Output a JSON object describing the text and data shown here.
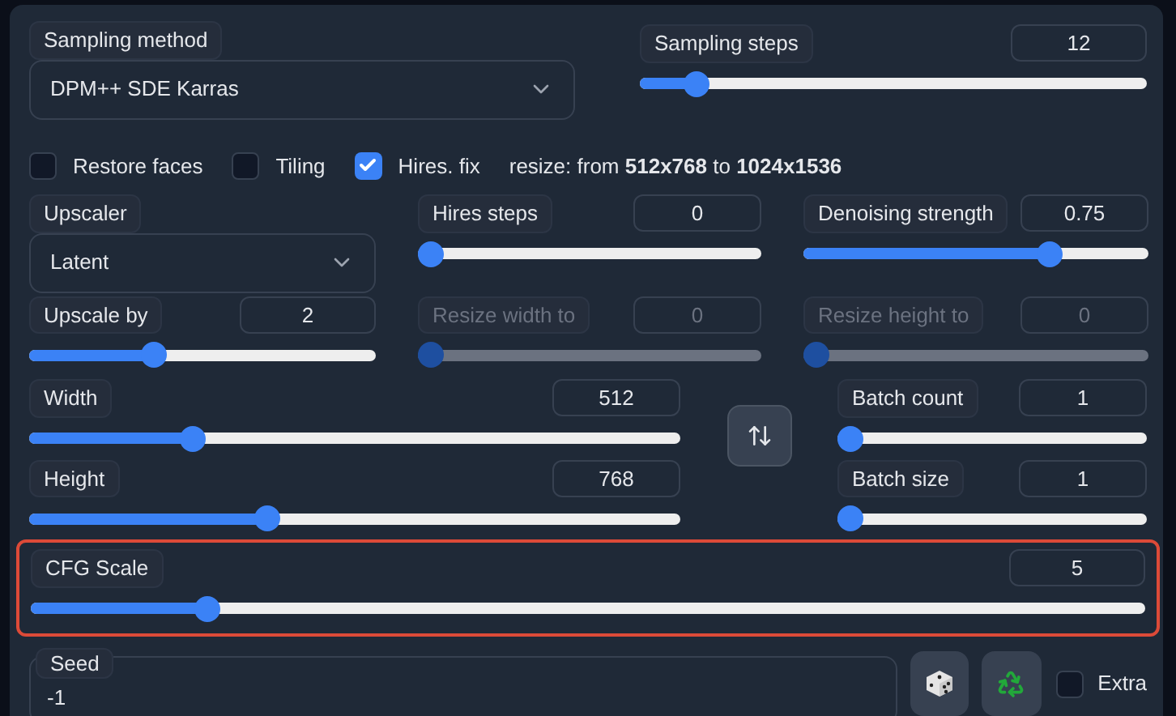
{
  "sampling_method": {
    "label": "Sampling method",
    "value": "DPM++ SDE Karras"
  },
  "sampling_steps": {
    "label": "Sampling steps",
    "value": "12",
    "level": 0.09,
    "disabled": false
  },
  "checkboxes": [
    {
      "label": "Restore faces",
      "checked": false
    },
    {
      "label": "Tiling",
      "checked": false
    },
    {
      "label": "Hires. fix",
      "checked": true
    }
  ],
  "resize_note": "resize: from **512x768** to **1024x1536**",
  "upscaler": {
    "label": "Upscaler",
    "value": "Latent"
  },
  "hires_sliders": [
    {
      "label": "Hires steps",
      "value": "0",
      "level": 0,
      "disabled": false
    },
    {
      "label": "Denoising strength",
      "value": "0.75",
      "level": 0.73,
      "disabled": false
    },
    {
      "label": "Upscale by",
      "value": "2",
      "level": 0.35,
      "disabled": false
    },
    {
      "label": "Resize width to",
      "value": "0",
      "level": 0,
      "disabled": true
    },
    {
      "label": "Resize height to",
      "value": "0",
      "level": 0,
      "disabled": true
    }
  ],
  "dimension_sliders": [
    {
      "label": "Width",
      "value": "512",
      "level": 0.24,
      "disabled": false
    },
    {
      "label": "Height",
      "value": "768",
      "level": 0.36,
      "disabled": false
    }
  ],
  "batch_sliders": [
    {
      "label": "Batch count",
      "value": "1",
      "level": 0,
      "disabled": false
    },
    {
      "label": "Batch size",
      "value": "1",
      "level": 0,
      "disabled": false
    }
  ],
  "cfg_scale": {
    "label": "CFG Scale",
    "value": "5",
    "level": 0.15,
    "disabled": false,
    "highlighted": true
  },
  "seed": {
    "label": "Seed",
    "value": "-1"
  },
  "extra": {
    "label": "Extra",
    "checked": false
  }
}
